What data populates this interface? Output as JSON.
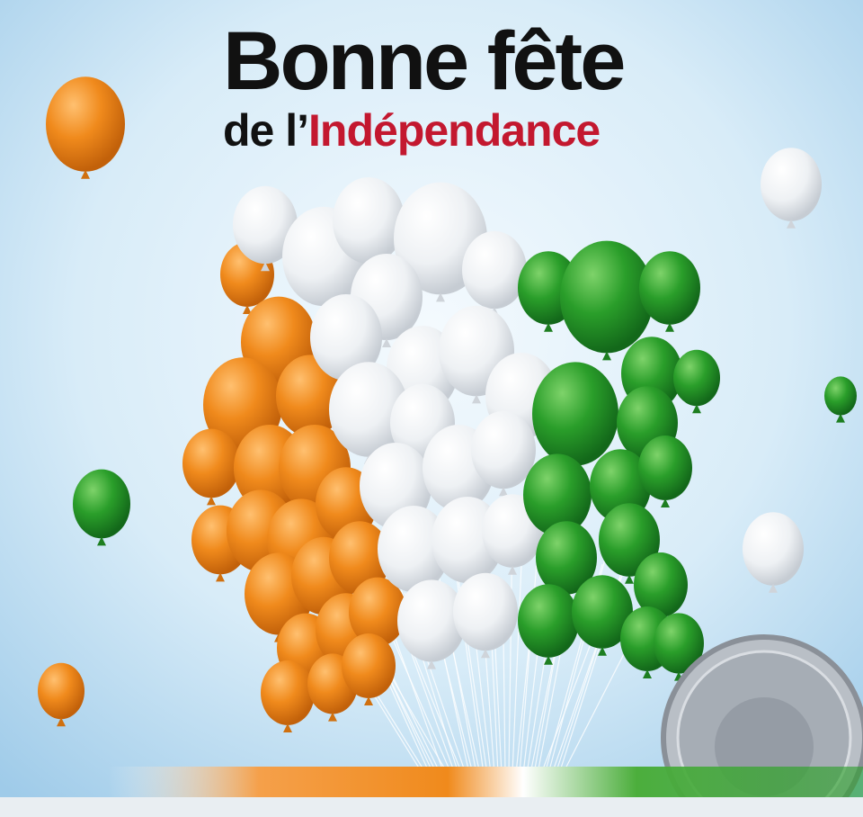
{
  "greeting": {
    "line1": "Bonne fête",
    "line2_prefix": "de l’",
    "line2_highlight": "Indépendance"
  },
  "colors": {
    "orange": "#f08a1c",
    "white": "#f4f6f8",
    "green": "#2a9e2a",
    "highlight_red": "#c3182f",
    "sky": "#cfe6f6"
  },
  "icons": [
    "balloon",
    "coat-of-arms-seal"
  ]
}
